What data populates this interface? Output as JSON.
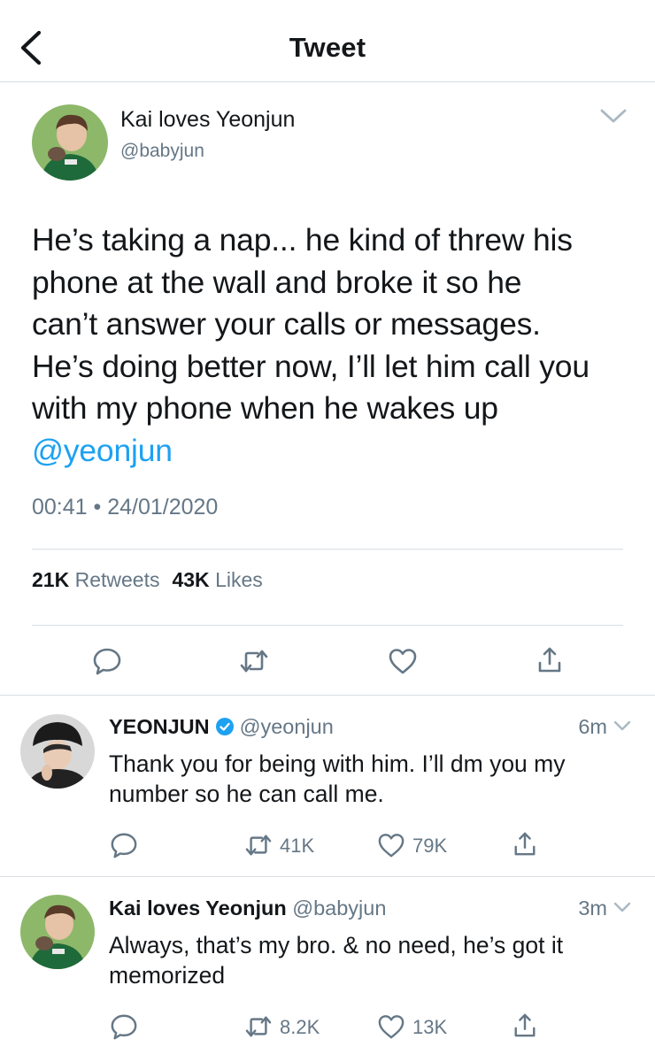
{
  "header": {
    "title": "Tweet"
  },
  "main_tweet": {
    "author_name": "Kai loves Yeonjun",
    "author_handle": "@babyjun",
    "text_lines": [
      "He’s taking a nap... he kind of threw his",
      "phone at the wall and broke it so he",
      "can’t answer your calls or messages.",
      "He’s doing better now, I’ll let him call you",
      "with my phone when he wakes up"
    ],
    "mention": "@yeonjun",
    "timestamp": "00:41 • 24/01/2020",
    "retweets_count": "21K",
    "retweets_label": "Retweets",
    "likes_count": "43K",
    "likes_label": "Likes"
  },
  "replies": [
    {
      "author_name": "YEONJUN",
      "author_handle": "@yeonjun",
      "verified": true,
      "time": "6m",
      "text": "Thank you for being with him. I’ll dm you my number so he can call me.",
      "retweets": "41K",
      "likes": "79K"
    },
    {
      "author_name": "Kai loves Yeonjun",
      "author_handle": "@babyjun",
      "verified": false,
      "time": "3m",
      "text": "Always, that’s my bro. & no need, he’s got it memorized",
      "retweets": "8.2K",
      "likes": "13K"
    }
  ],
  "colors": {
    "accent": "#1da1f2",
    "secondary_text": "#657786",
    "divider": "#d9dee2"
  },
  "icons": [
    "back-arrow-icon",
    "chevron-down-icon",
    "reply-icon",
    "retweet-icon",
    "like-icon",
    "share-icon",
    "verified-badge-icon"
  ]
}
